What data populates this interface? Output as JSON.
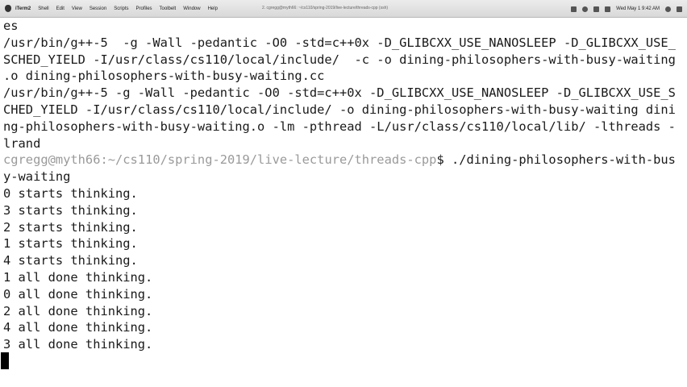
{
  "menubar": {
    "app": "iTerm2",
    "items": [
      "Shell",
      "Edit",
      "View",
      "Session",
      "Scripts",
      "Profiles",
      "Toolbelt",
      "Window",
      "Help"
    ],
    "title": "2. cgregg@myth66: ~/cs110/spring-2019/live-lecture/threads-cpp (ssh)",
    "clock": "Wed May 1 9:42 AM"
  },
  "terminal": {
    "lines": [
      "es",
      "/usr/bin/g++-5  -g -Wall -pedantic -O0 -std=c++0x -D_GLIBCXX_USE_NANOSLEEP -D_GLIBCXX_USE_",
      "SCHED_YIELD -I/usr/class/cs110/local/include/  -c -o dining-philosophers-with-busy-waiting",
      ".o dining-philosophers-with-busy-waiting.cc",
      "/usr/bin/g++-5 -g -Wall -pedantic -O0 -std=c++0x -D_GLIBCXX_USE_NANOSLEEP -D_GLIBCXX_USE_S",
      "CHED_YIELD -I/usr/class/cs110/local/include/ -o dining-philosophers-with-busy-waiting dini",
      "ng-philosophers-with-busy-waiting.o -lm -pthread -L/usr/class/cs110/local/lib/ -lthreads -",
      "lrand"
    ],
    "prompt": {
      "user": "cgregg@myth66",
      "path": ":~/cs110/spring-2019/live-lecture/threads-cpp",
      "command": "$ ./dining-philosophers-with-bus"
    },
    "output": [
      "y-waiting",
      "0 starts thinking.",
      "3 starts thinking.",
      "2 starts thinking.",
      "1 starts thinking.",
      "4 starts thinking.",
      "1 all done thinking.",
      "0 all done thinking.",
      "2 all done thinking.",
      "4 all done thinking.",
      "3 all done thinking."
    ]
  }
}
